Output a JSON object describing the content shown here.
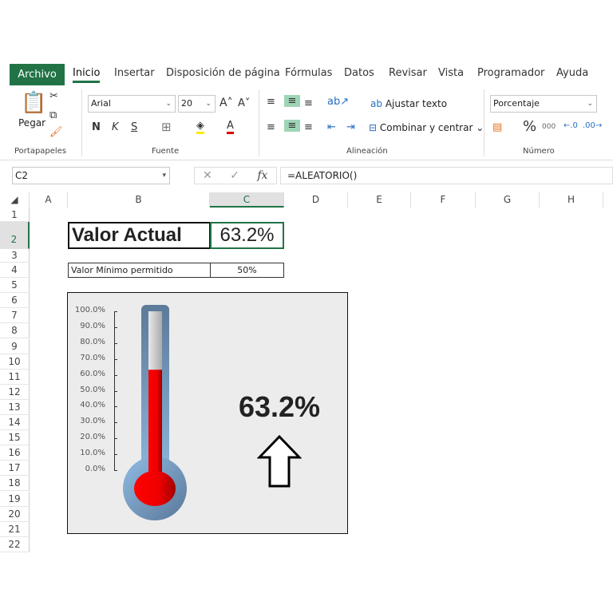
{
  "ribbon": {
    "tabs": [
      "Archivo",
      "Inicio",
      "Insertar",
      "Disposición de página",
      "Fórmulas",
      "Datos",
      "Revisar",
      "Vista",
      "Programador",
      "Ayuda"
    ],
    "paste_label": "Pegar",
    "font_name": "Arial",
    "font_size": "20",
    "bold": "N",
    "italic": "K",
    "underline": "S",
    "wrap_text": "Ajustar texto",
    "merge_center": "Combinar y centrar",
    "number_format": "Porcentaje",
    "percent": "%",
    "thousands": "000",
    "groups": [
      "Portapapeles",
      "Fuente",
      "Alineación",
      "Número"
    ]
  },
  "formula_bar": {
    "name_box": "C2",
    "fx": "fx",
    "formula": "=ALEATORIO()"
  },
  "columns": [
    "A",
    "B",
    "C",
    "D",
    "E",
    "F",
    "G",
    "H"
  ],
  "rows": [
    "1",
    "2",
    "3",
    "4",
    "5",
    "6",
    "7",
    "8",
    "9",
    "10",
    "11",
    "12",
    "13",
    "14",
    "15",
    "16",
    "17",
    "18",
    "19",
    "20",
    "21",
    "22"
  ],
  "cells": {
    "B2": "Valor Actual",
    "C2": "63.2%",
    "B4": "Valor Mínimo permitido",
    "C4": "50%"
  },
  "chart": {
    "value_label": "63.2%",
    "ticks": [
      "100.0%",
      "90.0%",
      "80.0%",
      "70.0%",
      "60.0%",
      "50.0%",
      "40.0%",
      "30.0%",
      "20.0%",
      "10.0%",
      "0.0%"
    ],
    "fill_fraction": 0.632,
    "indicator": "up-arrow-icon",
    "fill_color": "#ff0000"
  }
}
